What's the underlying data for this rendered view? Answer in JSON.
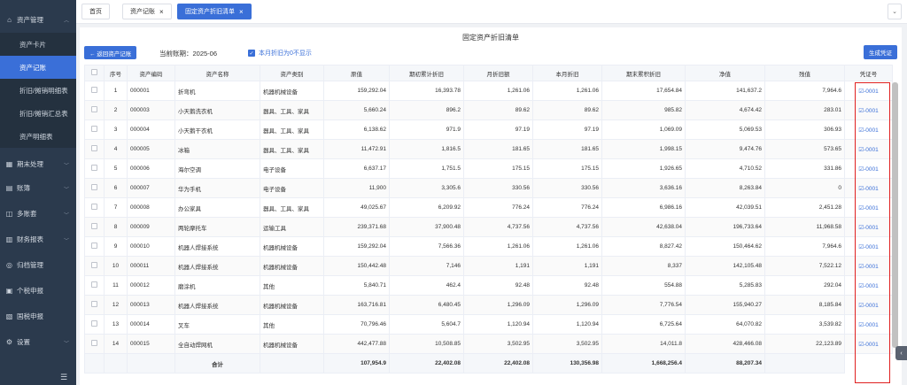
{
  "sidebar": {
    "groups": [
      {
        "label": "资产管理",
        "icon": "building-icon"
      },
      {
        "label": "期末处理",
        "icon": "calendar-icon"
      },
      {
        "label": "账簿",
        "icon": "book-icon"
      },
      {
        "label": "多账套",
        "icon": "layers-icon"
      },
      {
        "label": "财务报表",
        "icon": "chart-icon"
      },
      {
        "label": "归档管理",
        "icon": "archive-icon"
      },
      {
        "label": "个税申报",
        "icon": "tax-icon"
      },
      {
        "label": "国税申报",
        "icon": "report-icon"
      },
      {
        "label": "设置",
        "icon": "gear-icon"
      }
    ],
    "sub_items": [
      "资产卡片",
      "资产记账",
      "折旧/摊销明细表",
      "折旧/摊销汇总表",
      "资产明细表"
    ],
    "active_sub": "资产记账"
  },
  "tabs": [
    {
      "label": "首页",
      "closable": false,
      "active": false
    },
    {
      "label": "资产记账",
      "closable": true,
      "active": false
    },
    {
      "label": "固定资产折旧清单",
      "closable": true,
      "active": true
    }
  ],
  "toolbar": {
    "back_label": "← 返回资产记账",
    "period_label": "当前账期：2025-06",
    "checkbox_label": "本月折旧为0不显示",
    "checkbox_checked": true,
    "generate_label": "生成凭证"
  },
  "report_title": "固定资产折旧清单",
  "columns": [
    "序号",
    "资产编码",
    "资产名称",
    "资产类别",
    "原值",
    "期初累计折旧",
    "月折旧额",
    "本月折旧",
    "期末累积折旧",
    "净值",
    "残值",
    "凭证号"
  ],
  "rows": [
    [
      "1",
      "000001",
      "折弯机",
      "机器机械设备",
      "159,292.04",
      "16,393.78",
      "1,261.06",
      "1,261.06",
      "17,654.84",
      "141,637.2",
      "7,964.6",
      "-0001"
    ],
    [
      "2",
      "000003",
      "小天鹅洗衣机",
      "器具、工具、家具",
      "5,660.24",
      "896.2",
      "89.62",
      "89.62",
      "985.82",
      "4,674.42",
      "283.01",
      "-0001"
    ],
    [
      "3",
      "000004",
      "小天鹅干衣机",
      "器具、工具、家具",
      "6,138.62",
      "971.9",
      "97.19",
      "97.19",
      "1,069.09",
      "5,069.53",
      "306.93",
      "-0001"
    ],
    [
      "4",
      "000005",
      "冰箱",
      "器具、工具、家具",
      "11,472.91",
      "1,816.5",
      "181.65",
      "181.65",
      "1,998.15",
      "9,474.76",
      "573.65",
      "-0001"
    ],
    [
      "5",
      "000006",
      "海尔空调",
      "电子设备",
      "6,637.17",
      "1,751.5",
      "175.15",
      "175.15",
      "1,926.65",
      "4,710.52",
      "331.86",
      "-0001"
    ],
    [
      "6",
      "000007",
      "华为手机",
      "电子设备",
      "11,900",
      "3,305.6",
      "330.56",
      "330.56",
      "3,636.16",
      "8,263.84",
      "0",
      "-0001"
    ],
    [
      "7",
      "000008",
      "办公家具",
      "器具、工具、家具",
      "49,025.67",
      "6,209.92",
      "776.24",
      "776.24",
      "6,986.16",
      "42,039.51",
      "2,451.28",
      "-0001"
    ],
    [
      "8",
      "000009",
      "两轮摩托车",
      "运输工具",
      "239,371.68",
      "37,900.48",
      "4,737.56",
      "4,737.56",
      "42,638.04",
      "196,733.64",
      "11,968.58",
      "-0001"
    ],
    [
      "9",
      "000010",
      "机器人焊接系统",
      "机器机械设备",
      "159,292.04",
      "7,566.36",
      "1,261.06",
      "1,261.06",
      "8,827.42",
      "150,464.62",
      "7,964.6",
      "-0001"
    ],
    [
      "10",
      "000011",
      "机器人焊接系统",
      "机器机械设备",
      "150,442.48",
      "7,146",
      "1,191",
      "1,191",
      "8,337",
      "142,105.48",
      "7,522.12",
      "-0001"
    ],
    [
      "11",
      "000012",
      "磨涂机",
      "其他",
      "5,840.71",
      "462.4",
      "92.48",
      "92.48",
      "554.88",
      "5,285.83",
      "292.04",
      "-0001"
    ],
    [
      "12",
      "000013",
      "机器人焊接系统",
      "机器机械设备",
      "163,716.81",
      "6,480.45",
      "1,296.09",
      "1,296.09",
      "7,776.54",
      "155,940.27",
      "8,185.84",
      "-0001"
    ],
    [
      "13",
      "000014",
      "叉车",
      "其他",
      "70,796.46",
      "5,604.7",
      "1,120.94",
      "1,120.94",
      "6,725.64",
      "64,070.82",
      "3,539.82",
      "-0001"
    ],
    [
      "14",
      "000015",
      "全自动焊网机",
      "机器机械设备",
      "442,477.88",
      "10,508.85",
      "3,502.95",
      "3,502.95",
      "14,011.8",
      "428,466.08",
      "22,123.89",
      "-0001"
    ]
  ],
  "totals": {
    "label": "合计",
    "values": [
      "",
      "107,954.9",
      "22,402.08",
      "22,402.08",
      "130,356.98",
      "1,668,256.4",
      "88,207.34",
      ""
    ]
  },
  "colors": {
    "accent": "#3a6fd8",
    "sidebar_bg": "#2b3a4d",
    "highlight_box": "#e02020"
  }
}
